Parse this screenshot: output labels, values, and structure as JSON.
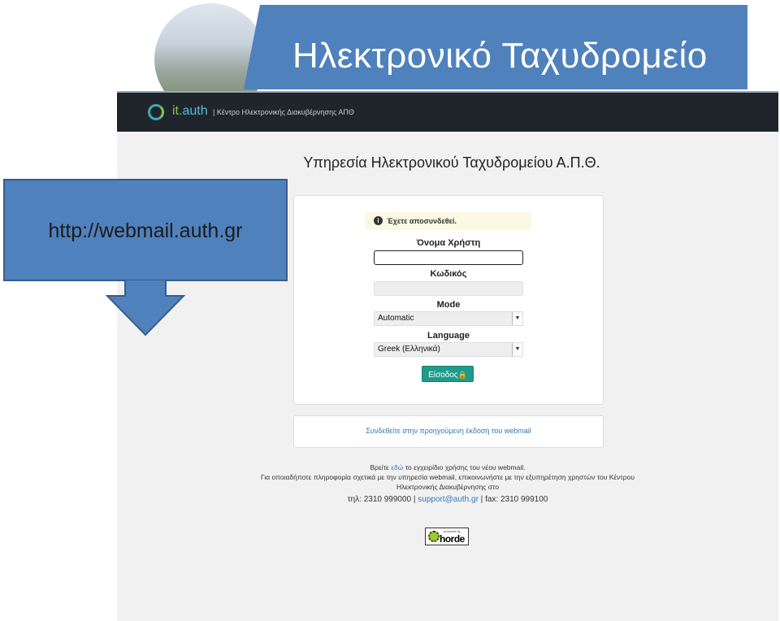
{
  "slide": {
    "title": "Ηλεκτρονικό Ταχυδρομείο",
    "callout_text": "http://webmail.auth.gr",
    "accent": "#4f81bd"
  },
  "header": {
    "logo_it": "it",
    "logo_auth": ".auth",
    "subtitle": "| Κέντρο Ηλεκτρονικής Διακυβέρνησης ΑΠΘ"
  },
  "page": {
    "service_title": "Υπηρεσία Ηλεκτρονικού Ταχυδρομείου Α.Π.Θ."
  },
  "login": {
    "notice": "Έχετε αποσυνδεθεί.",
    "notice_icon": "info-icon",
    "username_label": "Όνομα Χρήστη",
    "username_value": "",
    "password_label": "Κωδικός",
    "password_value": "",
    "mode_label": "Mode",
    "mode_selected": "Automatic",
    "language_label": "Language",
    "language_selected": "Greek (Ελληνικά)",
    "submit_label": "Είσοδος",
    "submit_icon": "lock-icon",
    "submit_color": "#1f9b8b"
  },
  "prev_version": {
    "link_text": "Συνδεθείτε στην προηγούμενη έκδοση του webmail"
  },
  "footer": {
    "line1_prefix": "Βρείτε",
    "line1_link": "εδώ",
    "line1_suffix": "το εγχειρίδιο χρήσης του νέου webmail.",
    "line2": "Για οποιαδήποτε πληροφορία σχετικά με την υπηρεσία webmail, επικοινωνήστε με την εξυπηρέτηση χρηστών του Κέντρου",
    "line3": "Ηλεκτρονικής Διακυβέρνησης στο",
    "phone": "τηλ: 2310 999000",
    "email": "support@auth.gr",
    "fax": "fax: 2310 999100",
    "horde_tag": "powered by",
    "horde_name": "horde"
  }
}
